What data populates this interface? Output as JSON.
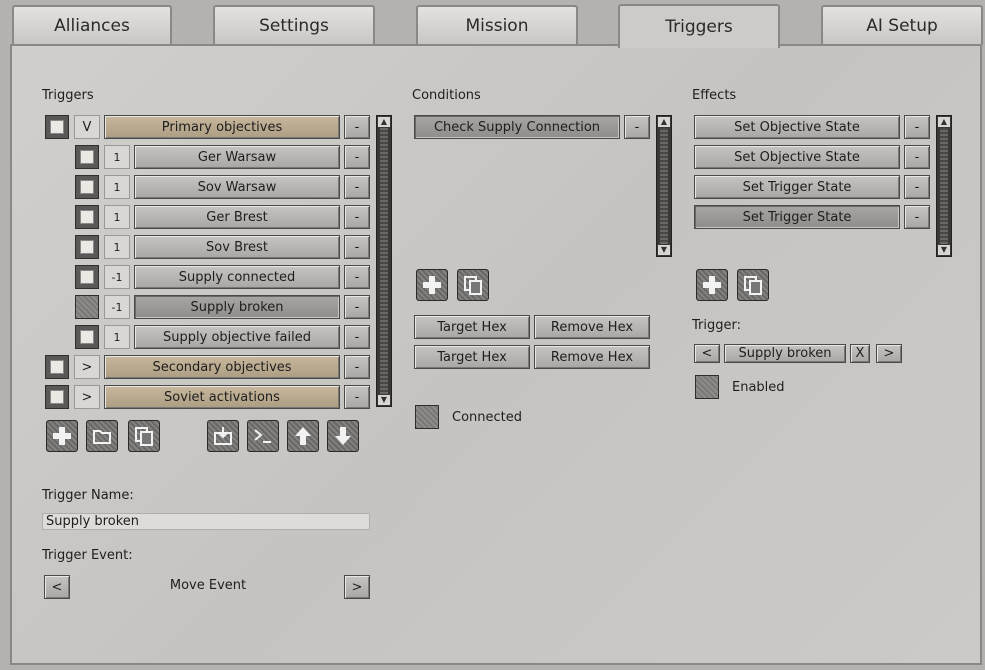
{
  "tabs": [
    "Alliances",
    "Settings",
    "Mission",
    "Triggers",
    "AI Setup"
  ],
  "triggers": {
    "heading": "Triggers",
    "groups": [
      {
        "toggle": "V",
        "label": "Primary objectives"
      },
      {
        "toggle": ">",
        "label": "Secondary objectives"
      },
      {
        "toggle": ">",
        "label": "Soviet activations"
      }
    ],
    "items": [
      {
        "num": "1",
        "label": "Ger Warsaw"
      },
      {
        "num": "1",
        "label": "Sov Warsaw"
      },
      {
        "num": "1",
        "label": "Ger Brest"
      },
      {
        "num": "1",
        "label": "Sov Brest"
      },
      {
        "num": "-1",
        "label": "Supply connected"
      },
      {
        "num": "-1",
        "label": "Supply broken"
      },
      {
        "num": "1",
        "label": "Supply objective failed"
      }
    ],
    "remove": "-"
  },
  "trigger_name": {
    "label": "Trigger Name:",
    "value": "Supply broken"
  },
  "trigger_event": {
    "label": "Trigger Event:",
    "value": "Move Event",
    "prev": "<",
    "next": ">"
  },
  "conditions": {
    "heading": "Conditions",
    "items": [
      "Check Supply Connection"
    ],
    "target_hex": "Target Hex",
    "remove_hex": "Remove Hex",
    "connected": "Connected"
  },
  "effects": {
    "heading": "Effects",
    "items": [
      "Set Objective State",
      "Set Objective State",
      "Set Trigger State",
      "Set Trigger State"
    ],
    "trigger_label": "Trigger:",
    "trigger_value": "Supply broken",
    "prev": "<",
    "clear": "X",
    "next": ">",
    "enabled": "Enabled"
  }
}
